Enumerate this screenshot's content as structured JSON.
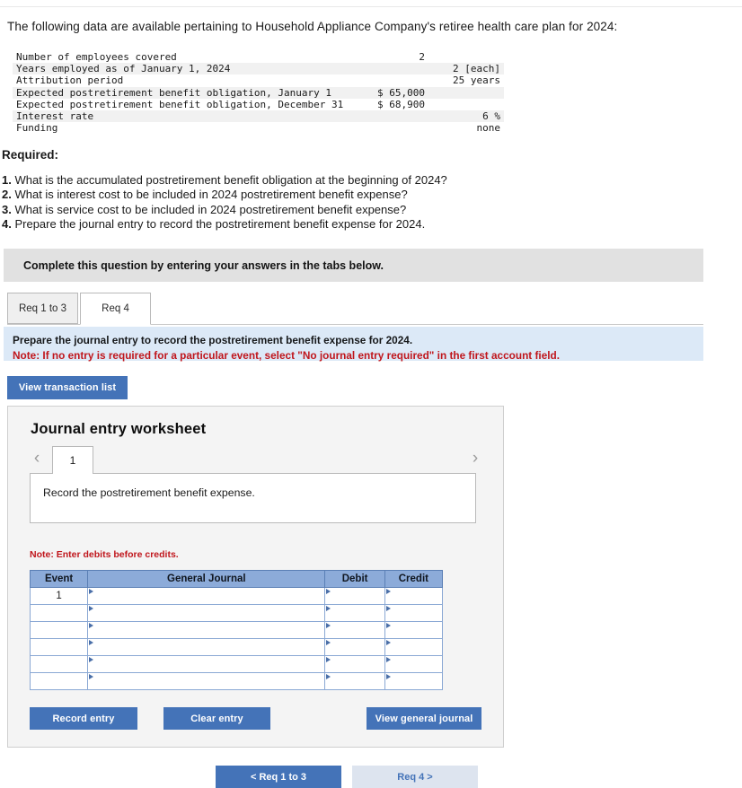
{
  "intro": "The following data are available pertaining to Household Appliance Company's retiree health care plan for 2024:",
  "facts": {
    "rows": [
      {
        "label": "Number of employees covered",
        "value": "2",
        "align": "mid"
      },
      {
        "label": "Years employed as of January 1, 2024",
        "value": "2 [each]",
        "align": "right"
      },
      {
        "label": "Attribution period",
        "value": "25 years",
        "align": "right"
      },
      {
        "label": "Expected postretirement benefit obligation, January 1",
        "value": "$ 65,000",
        "align": "far"
      },
      {
        "label": "Expected postretirement benefit obligation, December 31",
        "value": "$ 68,900",
        "align": "far"
      },
      {
        "label": "Interest rate",
        "value": "6 %",
        "align": "right"
      },
      {
        "label": "Funding",
        "value": "none",
        "align": "right"
      }
    ]
  },
  "required": {
    "heading": "Required:",
    "items": [
      {
        "num": "1.",
        "text": "What is the accumulated postretirement benefit obligation at the beginning of 2024?"
      },
      {
        "num": "2.",
        "text": "What is interest cost to be included in 2024 postretirement benefit expense?"
      },
      {
        "num": "3.",
        "text": "What is service cost to be included in 2024 postretirement benefit expense?"
      },
      {
        "num": "4.",
        "text": "Prepare the journal entry to record the postretirement benefit expense for 2024."
      }
    ]
  },
  "banner": {
    "text": "Complete this question by entering your answers in the tabs below."
  },
  "tabs": {
    "inactive_label": "Req 1 to 3",
    "active_label": "Req 4"
  },
  "blue_panel": {
    "line1": "Prepare the journal entry to record the postretirement benefit expense for 2024.",
    "line2": "Note: If no entry is required for a particular event, select \"No journal entry required\" in the first account field."
  },
  "buttons": {
    "view_transaction_list": "View transaction list",
    "record_entry": "Record entry",
    "clear_entry": "Clear entry",
    "view_general_journal": "View general journal"
  },
  "worksheet": {
    "title": "Journal entry worksheet",
    "prev_icon": "chevron-left-icon",
    "next_icon": "chevron-right-icon",
    "prev_glyph": "‹",
    "next_glyph": "›",
    "page_number": "1",
    "description": "Record the postretirement benefit expense.",
    "note": "Note: Enter debits before credits.",
    "table": {
      "headers": [
        "Event",
        "General Journal",
        "Debit",
        "Credit"
      ],
      "rows": [
        {
          "event": "1",
          "general_journal": "",
          "debit": "",
          "credit": ""
        },
        {
          "event": "",
          "general_journal": "",
          "debit": "",
          "credit": ""
        },
        {
          "event": "",
          "general_journal": "",
          "debit": "",
          "credit": ""
        },
        {
          "event": "",
          "general_journal": "",
          "debit": "",
          "credit": ""
        },
        {
          "event": "",
          "general_journal": "",
          "debit": "",
          "credit": ""
        },
        {
          "event": "",
          "general_journal": "",
          "debit": "",
          "credit": ""
        }
      ]
    }
  },
  "bottom_nav": {
    "prev_label": "< Req 1 to 3",
    "next_label": "Req 4 >"
  },
  "colors": {
    "primary_button": "#4473b8",
    "table_header": "#8cabd9",
    "banner": "#e1e1e1",
    "blue_panel": "#dce9f7",
    "note_red": "#c0161c"
  }
}
